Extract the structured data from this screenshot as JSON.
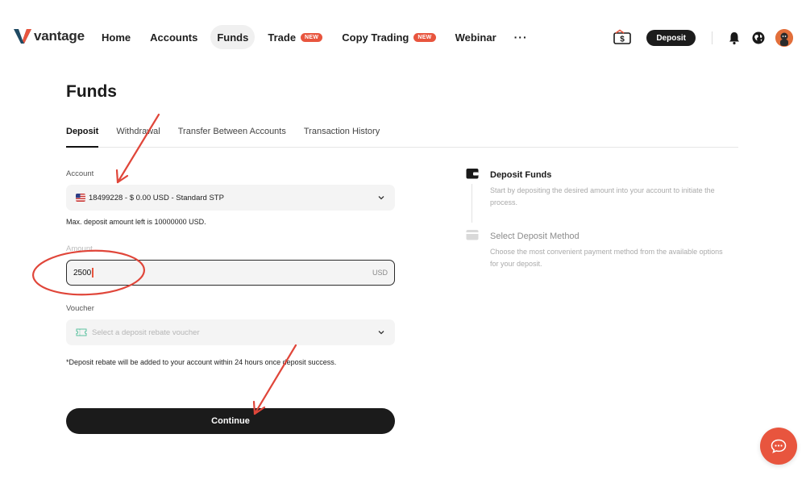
{
  "brand": {
    "name": "vantage",
    "accent": "#e8553e",
    "logo_icon": "vantage-v-logo"
  },
  "nav": {
    "items": [
      {
        "label": "Home"
      },
      {
        "label": "Accounts"
      },
      {
        "label": "Funds"
      },
      {
        "label": "Trade",
        "badge": "NEW"
      },
      {
        "label": "Copy Trading",
        "badge": "NEW"
      },
      {
        "label": "Webinar"
      }
    ],
    "active": "Funds",
    "more_label": "···"
  },
  "toolbar": {
    "cashback_icon": "cashback-ticket-icon",
    "deposit_label": "Deposit",
    "bell_icon": "bell-icon",
    "globe_icon": "globe-icon",
    "avatar_icon": "avatar"
  },
  "page": {
    "title": "Funds"
  },
  "tabs": [
    {
      "label": "Deposit",
      "active": true
    },
    {
      "label": "Withdrawal"
    },
    {
      "label": "Transfer Between Accounts"
    },
    {
      "label": "Transaction History"
    }
  ],
  "form": {
    "account_label": "Account",
    "account_value": "18499228 - $ 0.00 USD - Standard STP",
    "account_flag": "us-flag-icon",
    "max_note": "Max. deposit amount left is 10000000 USD.",
    "amount_label": "Amount",
    "amount_value": "2500",
    "amount_currency": "USD",
    "voucher_label": "Voucher",
    "voucher_placeholder": "Select a deposit rebate voucher",
    "rebate_note": "*Deposit rebate will be added to your account within 24 hours once deposit success.",
    "continue_label": "Continue"
  },
  "steps": [
    {
      "title": "Deposit Funds",
      "desc": "Start by depositing the desired amount into your account to initiate the process.",
      "state": "current"
    },
    {
      "title": "Select Deposit Method",
      "desc": "Choose the most convenient payment method from the available options for your deposit.",
      "state": "pending"
    }
  ],
  "chat": {
    "icon": "chat-bubble-icon"
  },
  "colors": {
    "annotation": "#e0463a",
    "dark_button": "#1b1b1b",
    "field_bg": "#f4f4f4"
  }
}
